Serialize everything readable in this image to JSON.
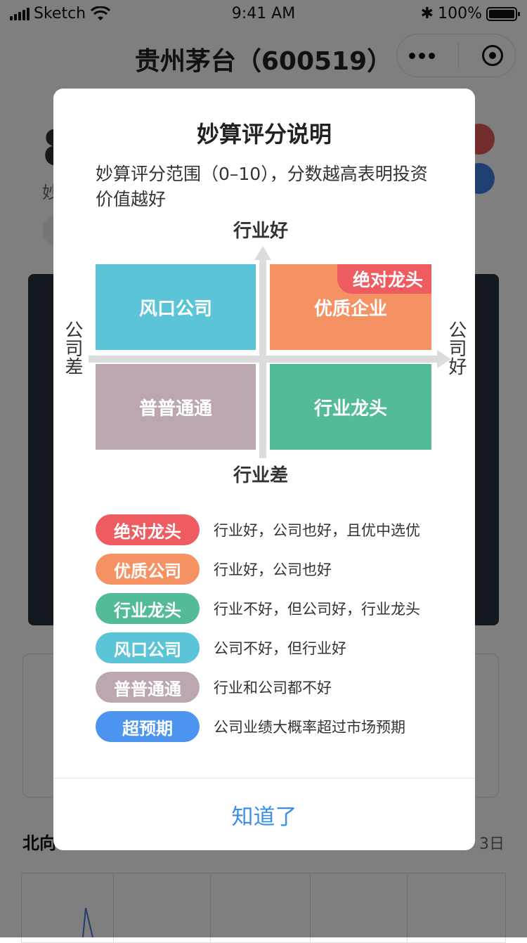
{
  "status_bar": {
    "carrier": "Sketch",
    "time": "9:41 AM",
    "battery": "100%",
    "battery_level": 1.0
  },
  "nav": {
    "title": "贵州茅台（600519）"
  },
  "background": {
    "score_char": "8",
    "score_sub_char": "妙",
    "north_label": "北向",
    "date_suffix": "3日"
  },
  "modal": {
    "title": "妙算评分说明",
    "description": "妙算评分范围（0–10），分数越高表明投资价值越好",
    "axes": {
      "top": "行业好",
      "bottom": "行业差",
      "left": "公司差",
      "right": "公司好"
    },
    "quadrants": {
      "top_left": {
        "label": "风口公司",
        "color": "#5bc4d6"
      },
      "top_right": {
        "label": "优质企业",
        "color": "#f59264",
        "badge": "绝对龙头",
        "badge_color": "#ee5b60"
      },
      "bottom_left": {
        "label": "普普通通",
        "color": "#bca6b2"
      },
      "bottom_right": {
        "label": "行业龙头",
        "color": "#53bb95"
      }
    },
    "legend": [
      {
        "tag": "绝对龙头",
        "text": "行业好，公司也好，且优中选优",
        "color": "#ee5b60"
      },
      {
        "tag": "优质公司",
        "text": "行业好，公司也好",
        "color": "#f59264"
      },
      {
        "tag": "行业龙头",
        "text": "行业不好，但公司好，行业龙头",
        "color": "#53bb95"
      },
      {
        "tag": "风口公司",
        "text": "公司不好，但行业好",
        "color": "#5bc4d6"
      },
      {
        "tag": "普普通通",
        "text": "行业和公司都不好",
        "color": "#bca6b2"
      },
      {
        "tag": "超预期",
        "text": "公司业绩大概率超过市场预期",
        "color": "#4d94f0"
      }
    ],
    "confirm_label": "知道了"
  }
}
